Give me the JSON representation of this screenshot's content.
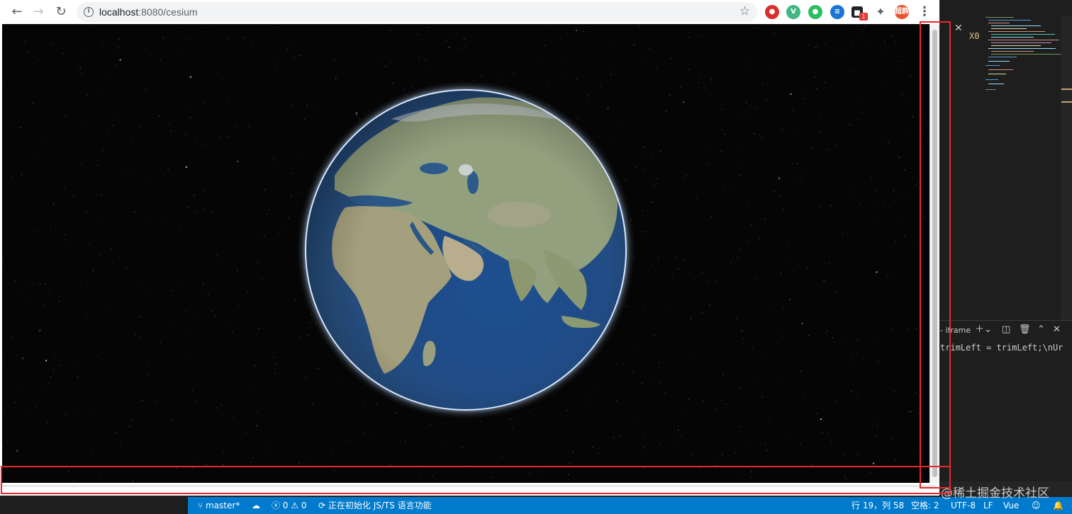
{
  "browser": {
    "url_host": "localhost",
    "url_path": ":8080/cesium",
    "extensions": [
      {
        "name": "adblock-icon",
        "color": "#d9302c",
        "glyph": "●"
      },
      {
        "name": "vue-devtools-icon",
        "color": "#41b883",
        "glyph": "V"
      },
      {
        "name": "evernote-icon",
        "color": "#2dbe60",
        "glyph": "●"
      },
      {
        "name": "raindrop-icon",
        "color": "#1976d2",
        "glyph": "≡"
      },
      {
        "name": "extension-icon",
        "color": "#202124",
        "glyph": "■"
      },
      {
        "name": "puzzle-icon",
        "color": "#5f6368",
        "glyph": "✦"
      },
      {
        "name": "profile-avatar",
        "color": "#e8542b",
        "glyph": "超群"
      }
    ],
    "ext_badge": "1"
  },
  "vscode": {
    "tab_text": "X0",
    "panel_title": "- iframe",
    "terminal_line": "trimLeft = trimLeft;\\nUr",
    "status": {
      "branch": "master*",
      "problems": "ⓧ 0 ⚠ 0",
      "init_text": "正在初始化 JS/TS 语言功能",
      "position": "行 19，列 58",
      "spaces": "空格: 2",
      "encoding": "UTF-8",
      "eol": "LF",
      "language": "Vue"
    },
    "watermark": "@稀土掘金技术社区"
  },
  "colors": {
    "status_bar": "#007acc",
    "highlight_box": "#e8272d",
    "space": "#050505"
  }
}
